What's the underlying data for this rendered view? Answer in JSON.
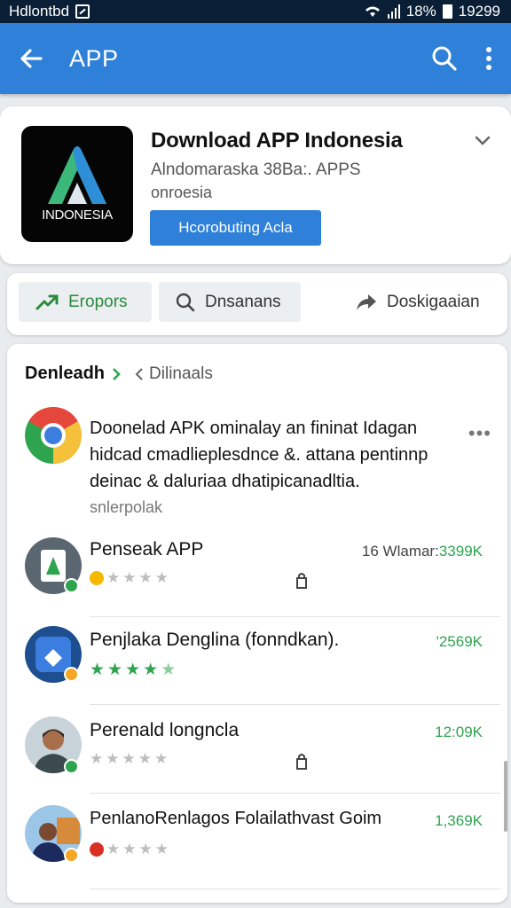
{
  "status_bar": {
    "carrier": "Hdlontbd",
    "battery": "18%",
    "time": "19299"
  },
  "app_bar": {
    "title": "APP"
  },
  "header": {
    "app_name": "Download APP Indonesia",
    "subtitle_1": "Alndomaraska 38Ba:. APPS",
    "subtitle_2": "onroesia",
    "install_label": "Hcorobuting Acla",
    "logo_text": "INDONESIA"
  },
  "tabs": [
    {
      "label": "Eropors",
      "icon": "trending-up-icon"
    },
    {
      "label": "Dnsanans",
      "icon": "search-icon"
    },
    {
      "label": "Doskigaaian",
      "icon": "share-icon"
    }
  ],
  "section": {
    "title": "Denleadh",
    "filter_label": "Dilinaals"
  },
  "featured": {
    "text": "Doonelad APK ominalay an fininat Idagan hidcad cmadlieplesdnce &. attana pentinnp deinac & daluriaa dhatipicanadltia.",
    "subtext": "snlerpolak"
  },
  "items": [
    {
      "name": "Penseak APP",
      "meta_prefix": "16 Wlamar:",
      "meta_value": "3399K",
      "stars": 0,
      "dot_color": "#f5b800"
    },
    {
      "name": "Penjlaka Denglina (fonndkan).",
      "meta_prefix": "",
      "meta_value": "'2569K",
      "stars": 4,
      "dot_color": ""
    },
    {
      "name": "Perenald longncla",
      "meta_prefix": "",
      "meta_value": "12:09K",
      "stars": 0,
      "dot_color": ""
    },
    {
      "name": "PenlanoRenlagos Folailathvast Goim",
      "meta_prefix": "",
      "meta_value": "1,369K",
      "stars": 0,
      "dot_color": "#d93025"
    }
  ],
  "colors": {
    "primary": "#2f80d8",
    "green": "#2ea44f",
    "status_bar": "#0a1f36"
  }
}
